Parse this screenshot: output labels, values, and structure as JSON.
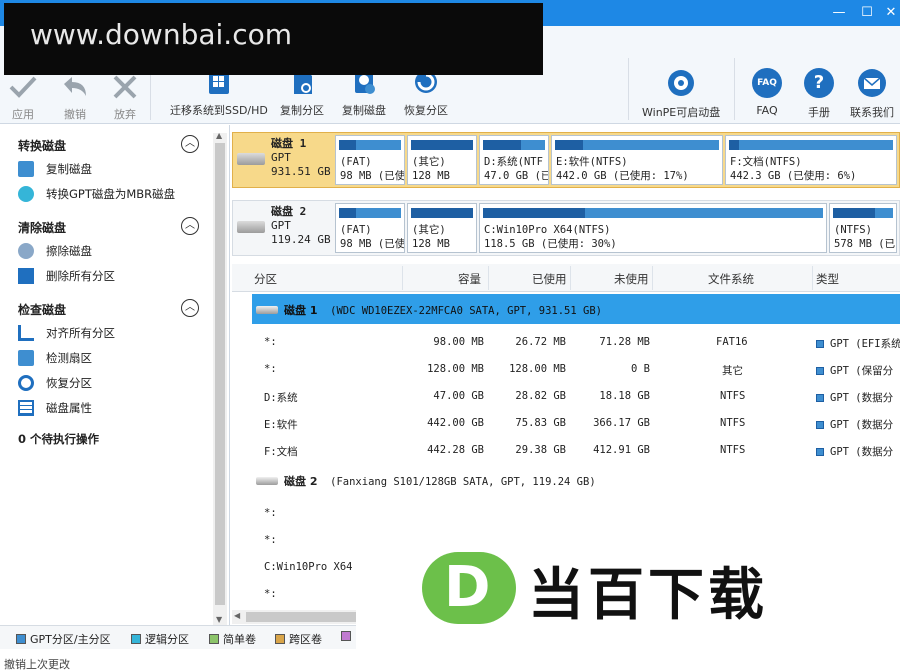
{
  "window": {
    "minimize": "—",
    "maximize": "☐",
    "close": "✕"
  },
  "watermark": "www.downbai.com",
  "toolbar": {
    "apply": "应用",
    "undo": "撤销",
    "discard": "放弃",
    "migrate": "迁移系统到SSD/HD",
    "copy_partition": "复制分区",
    "copy_disk": "复制磁盘",
    "recover_partition": "恢复分区",
    "winpe": "WinPE可启动盘",
    "faq": "FAQ",
    "manual": "手册",
    "contact": "联系我们",
    "faq_badge": "FAQ",
    "manual_badge": "?"
  },
  "sidebar": {
    "groups": [
      {
        "label": "转换磁盘",
        "items": [
          "复制磁盘",
          "转换GPT磁盘为MBR磁盘"
        ]
      },
      {
        "label": "清除磁盘",
        "items": [
          "擦除磁盘",
          "删除所有分区"
        ]
      },
      {
        "label": "检查磁盘",
        "items": [
          "对齐所有分区",
          "检测扇区",
          "恢复分区",
          "磁盘属性"
        ]
      }
    ],
    "collapse_glyph": "︿",
    "pending": "0 个待执行操作"
  },
  "diskmap": {
    "disk1": {
      "name": "磁盘 1",
      "style": "GPT",
      "size": "931.51 GB",
      "partitions": [
        {
          "label": "(FAT)",
          "info": "98 MB (已使",
          "used_pct": 27
        },
        {
          "label": "(其它)",
          "info": "128 MB",
          "used_pct": 100
        },
        {
          "label": "D:系统(NTF",
          "info": "47.0 GB (已",
          "used_pct": 61
        },
        {
          "label": "E:软件(NTFS)",
          "info": "442.0 GB (已使用: 17%)",
          "used_pct": 17
        },
        {
          "label": "F:文档(NTFS)",
          "info": "442.3 GB (已使用: 6%)",
          "used_pct": 6
        }
      ]
    },
    "disk2": {
      "name": "磁盘 2",
      "style": "GPT",
      "size": "119.24 GB",
      "partitions": [
        {
          "label": "(FAT)",
          "info": "98 MB (已使",
          "used_pct": 27
        },
        {
          "label": "(其它)",
          "info": "128 MB",
          "used_pct": 100
        },
        {
          "label": "C:Win10Pro X64(NTFS)",
          "info": "118.5 GB (已使用: 30%)",
          "used_pct": 30
        },
        {
          "label": "(NTFS)",
          "info": "578 MB (已",
          "used_pct": 70
        }
      ]
    }
  },
  "table": {
    "headers": [
      "分区",
      "容量",
      "已使用",
      "未使用",
      "文件系统",
      "类型"
    ],
    "disk1_header": {
      "name": "磁盘 1",
      "detail": "(WDC WD10EZEX-22MFCA0 SATA, GPT, 931.51 GB)"
    },
    "disk1_rows": [
      {
        "name": "*:",
        "cap": "98.00 MB",
        "used": "26.72 MB",
        "free": "71.28 MB",
        "fs": "FAT16",
        "type": "GPT (EFI系统"
      },
      {
        "name": "*:",
        "cap": "128.00 MB",
        "used": "128.00 MB",
        "free": "0 B",
        "fs": "其它",
        "type": "GPT (保留分"
      },
      {
        "name": "D:系统",
        "cap": "47.00 GB",
        "used": "28.82 GB",
        "free": "18.18 GB",
        "fs": "NTFS",
        "type": "GPT (数据分"
      },
      {
        "name": "E:软件",
        "cap": "442.00 GB",
        "used": "75.83 GB",
        "free": "366.17 GB",
        "fs": "NTFS",
        "type": "GPT (数据分"
      },
      {
        "name": "F:文档",
        "cap": "442.28 GB",
        "used": "29.38 GB",
        "free": "412.91 GB",
        "fs": "NTFS",
        "type": "GPT (数据分"
      }
    ],
    "disk2_header": {
      "name": "磁盘 2",
      "detail": "(Fanxiang S101/128GB SATA, GPT, 119.24 GB)"
    },
    "disk2_rows": [
      {
        "name": "*:"
      },
      {
        "name": "*:"
      },
      {
        "name": "C:Win10Pro X64"
      },
      {
        "name": "*:"
      }
    ]
  },
  "legend": [
    {
      "label": "GPT分区/主分区",
      "color": "#3e8ed0"
    },
    {
      "label": "逻辑分区",
      "color": "#35b5d8"
    },
    {
      "label": "简单卷",
      "color": "#8cc46a"
    },
    {
      "label": "跨区卷",
      "color": "#d9a54a"
    },
    {
      "label": "",
      "color": "#c07ad0"
    }
  ],
  "status": "撤销上次更改",
  "logo": {
    "letter": "D",
    "text": "当百下载"
  }
}
